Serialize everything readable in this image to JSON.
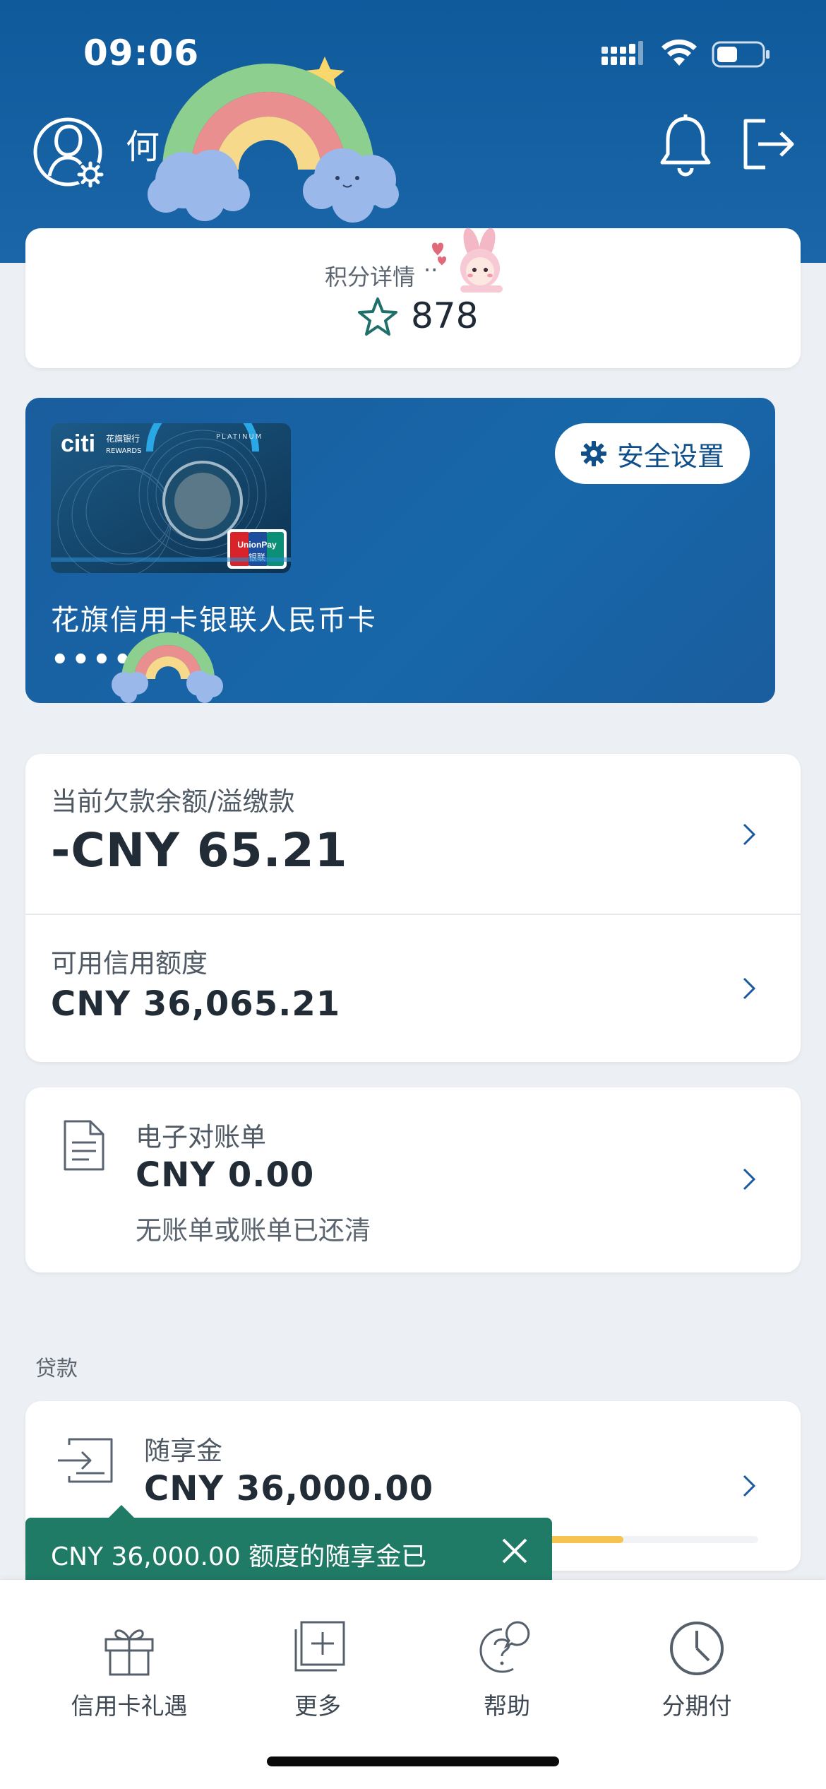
{
  "status_bar": {
    "time": "09:06"
  },
  "header": {
    "user_name": "何"
  },
  "points": {
    "label": "积分详情",
    "dots": "··",
    "value": "878"
  },
  "card": {
    "brand_text": "citi",
    "brand_sub": "花旗银行",
    "rewards_text": "REWARDS",
    "tier_text": "PLATINUM",
    "network_text": "UnionPay",
    "network_cn": "银联",
    "security_button": "安全设置",
    "name": "花旗信用卡银联人民币卡",
    "masked_number": "••••"
  },
  "balance": {
    "current_label": "当前欠款余额/溢缴款",
    "current_value": "-CNY 65.21",
    "available_label": "可用信用额度",
    "available_value": "CNY 36,065.21"
  },
  "statement": {
    "title": "电子对账单",
    "value": "CNY 0.00",
    "note": "无账单或账单已还清"
  },
  "loans": {
    "section_label": "贷款",
    "title": "随享金",
    "value": "CNY 36,000.00",
    "progress": 0.78
  },
  "toast": {
    "text": "CNY 36,000.00 额度的随享金已"
  },
  "bottom_nav": [
    {
      "label": "信用卡礼遇",
      "icon": "gift-icon"
    },
    {
      "label": "更多",
      "icon": "add-square-icon"
    },
    {
      "label": "帮助",
      "icon": "help-chat-icon"
    },
    {
      "label": "分期付",
      "icon": "clock-icon"
    }
  ],
  "colors": {
    "header_blue": "#0f5a9b",
    "card_blue": "#1767a9",
    "toast_green": "#1f7a66",
    "progress_yellow": "#f6c34e",
    "accent_teal": "#1f6f6a"
  }
}
